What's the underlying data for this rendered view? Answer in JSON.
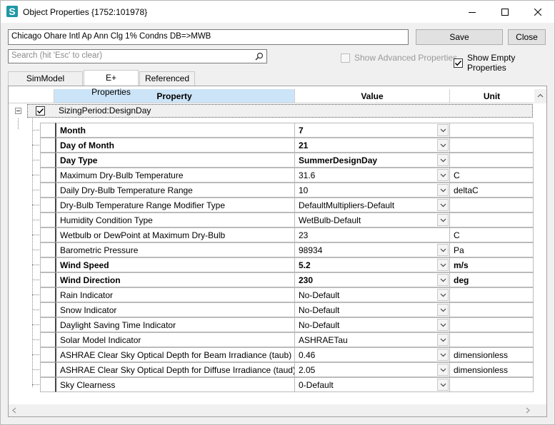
{
  "window": {
    "title": "Object Properties {1752:101978}",
    "app_icon_letter": "S"
  },
  "header": {
    "object_name": "Chicago Ohare Intl Ap Ann Clg 1% Condns DB=>MWB",
    "save_label": "Save",
    "close_label": "Close",
    "search_placeholder": "Search (hit 'Esc' to clear)",
    "show_advanced_label": "Show Advanced Properties",
    "show_advanced_checked": false,
    "show_empty_label": "Show Empty Properties",
    "show_empty_checked": true
  },
  "tabs": [
    {
      "label": "SimModel Properties",
      "active": false
    },
    {
      "label": "E+ Properties",
      "active": true
    },
    {
      "label": "Referenced By",
      "active": false
    }
  ],
  "grid": {
    "columns": {
      "property": "Property",
      "value": "Value",
      "unit": "Unit"
    },
    "group": {
      "label": "SizingPeriod:DesignDay",
      "checked": true
    },
    "rows": [
      {
        "property": "Month",
        "value": "7",
        "unit": "",
        "bold": true,
        "dropdown": true
      },
      {
        "property": "Day of Month",
        "value": "21",
        "unit": "",
        "bold": true,
        "dropdown": true
      },
      {
        "property": "Day Type",
        "value": "SummerDesignDay",
        "unit": "",
        "bold": true,
        "dropdown": true
      },
      {
        "property": "Maximum Dry-Bulb Temperature",
        "value": "31.6",
        "unit": "C",
        "bold": false,
        "dropdown": true
      },
      {
        "property": "Daily Dry-Bulb Temperature Range",
        "value": "10",
        "unit": "deltaC",
        "bold": false,
        "dropdown": true
      },
      {
        "property": "Dry-Bulb Temperature Range Modifier Type",
        "value": "DefaultMultipliers-Default",
        "unit": "",
        "bold": false,
        "dropdown": true
      },
      {
        "property": "Humidity Condition Type",
        "value": "WetBulb-Default",
        "unit": "",
        "bold": false,
        "dropdown": true
      },
      {
        "property": "Wetbulb or DewPoint at Maximum Dry-Bulb",
        "value": "23",
        "unit": "C",
        "bold": false,
        "dropdown": false
      },
      {
        "property": "Barometric Pressure",
        "value": "98934",
        "unit": "Pa",
        "bold": false,
        "dropdown": true
      },
      {
        "property": "Wind Speed",
        "value": "5.2",
        "unit": "m/s",
        "bold": true,
        "dropdown": true
      },
      {
        "property": "Wind Direction",
        "value": "230",
        "unit": "deg",
        "bold": true,
        "dropdown": true
      },
      {
        "property": "Rain Indicator",
        "value": "No-Default",
        "unit": "",
        "bold": false,
        "dropdown": true
      },
      {
        "property": "Snow Indicator",
        "value": "No-Default",
        "unit": "",
        "bold": false,
        "dropdown": true
      },
      {
        "property": "Daylight Saving Time Indicator",
        "value": "No-Default",
        "unit": "",
        "bold": false,
        "dropdown": true
      },
      {
        "property": "Solar Model Indicator",
        "value": "ASHRAETau",
        "unit": "",
        "bold": false,
        "dropdown": true
      },
      {
        "property": "ASHRAE Clear Sky Optical Depth for Beam Irradiance (taub)",
        "value": "0.46",
        "unit": "dimensionless",
        "bold": false,
        "dropdown": true
      },
      {
        "property": "ASHRAE Clear Sky Optical Depth for Diffuse Irradiance (taud)",
        "value": "2.05",
        "unit": "dimensionless",
        "bold": false,
        "dropdown": true
      },
      {
        "property": "Sky Clearness",
        "value": "0-Default",
        "unit": "",
        "bold": false,
        "dropdown": true
      }
    ]
  },
  "colors": {
    "header_highlight": "#cce4f7",
    "app_icon": "#1f97a6"
  }
}
